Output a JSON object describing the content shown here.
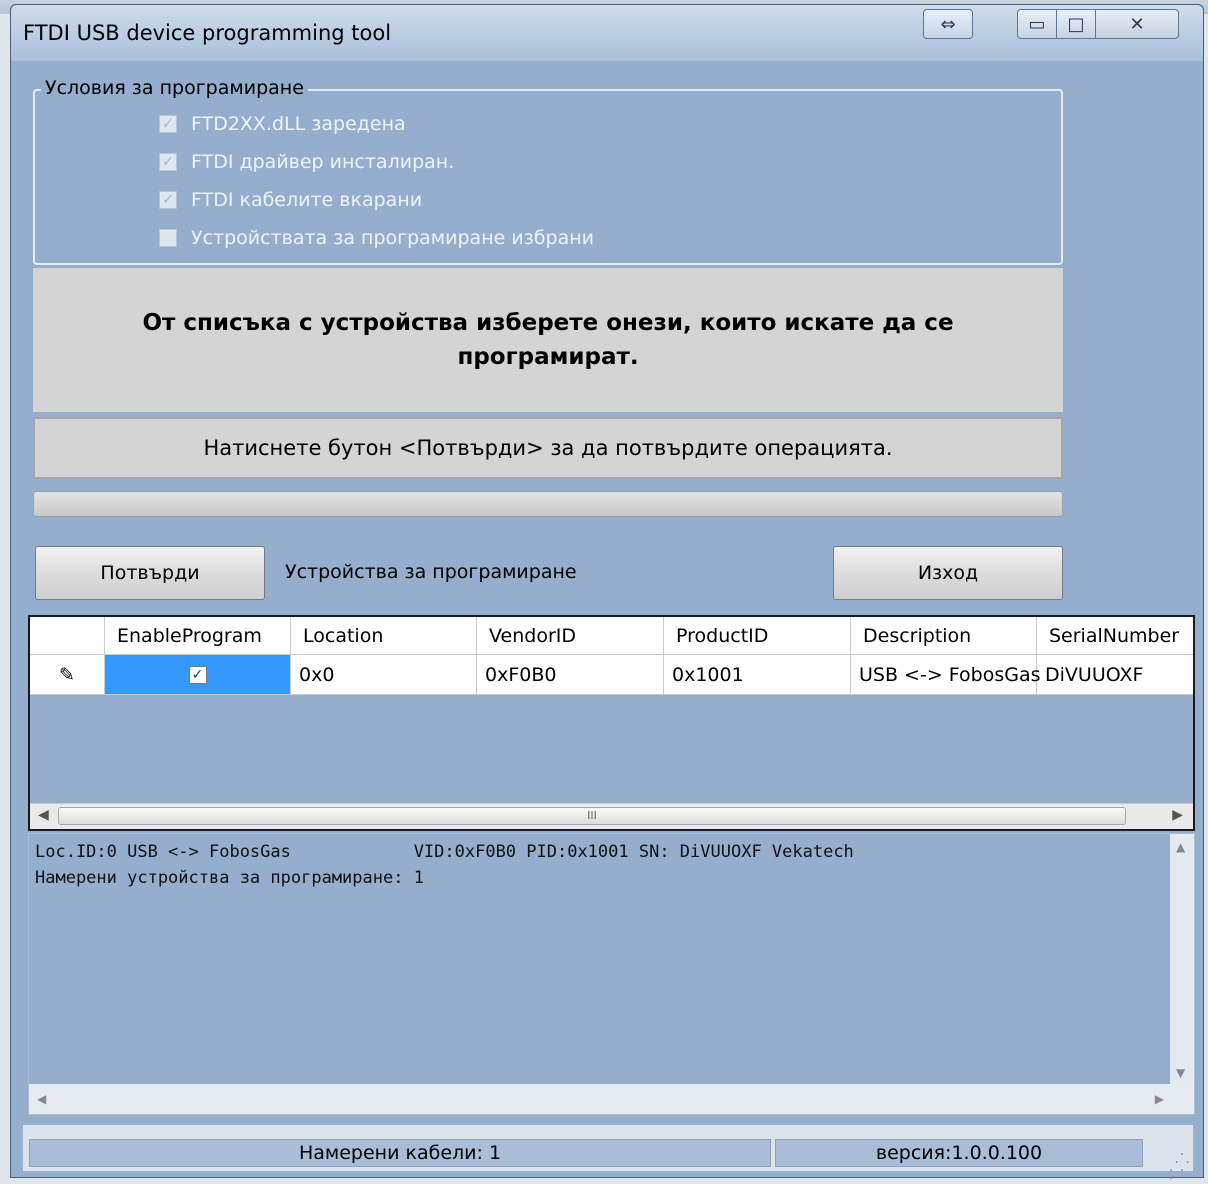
{
  "window": {
    "title": "FTDI USB device programming tool",
    "resize_icon": "⇔",
    "min_icon": "▭",
    "max_icon": "□",
    "close_icon": "✕"
  },
  "conditions": {
    "legend": "Условия за програмиране",
    "items": [
      {
        "label": "FTD2XX.dLL заредена",
        "checked": true
      },
      {
        "label": "FTDI драйвер инсталиран.",
        "checked": true
      },
      {
        "label": "FTDI кабелите вкарани",
        "checked": true
      },
      {
        "label": "Устройствата за програмиране избрани",
        "checked": false
      }
    ]
  },
  "instruction": "От списъка с устройства изберете онези, които искате да се програмират.",
  "message": "Натиснете бутон <Потвърди> за да потвърдите операцията.",
  "buttons": {
    "confirm": "Потвърди",
    "exit": "Изход"
  },
  "devices_label": "Устройства за програмиране",
  "grid": {
    "columns": [
      "EnableProgram",
      "Location",
      "VendorID",
      "ProductID",
      "Description",
      "SerialNumber"
    ],
    "rows": [
      {
        "row_icon": "✎",
        "EnableProgram": "✓",
        "Location": "0x0",
        "VendorID": "0xF0B0",
        "ProductID": "0x1001",
        "Description": "USB <-> FobosGas",
        "SerialNumber": "DiVUUOXF"
      }
    ],
    "scroll_thumb_label": "III"
  },
  "log": {
    "lines": [
      "Loc.ID:0 USB <-> FobosGas            VID:0xF0B0 PID:0x1001 SN: DiVUUOXF Vekatech",
      "Намерени устройства за програмиране: 1"
    ]
  },
  "status": {
    "cables": "Намерени кабели: 1",
    "version": "версия:1.0.0.100"
  },
  "colors": {
    "window_bg": "#95aecd",
    "selected_cell": "#3399ff",
    "panel_gray": "#d4d4d4"
  }
}
